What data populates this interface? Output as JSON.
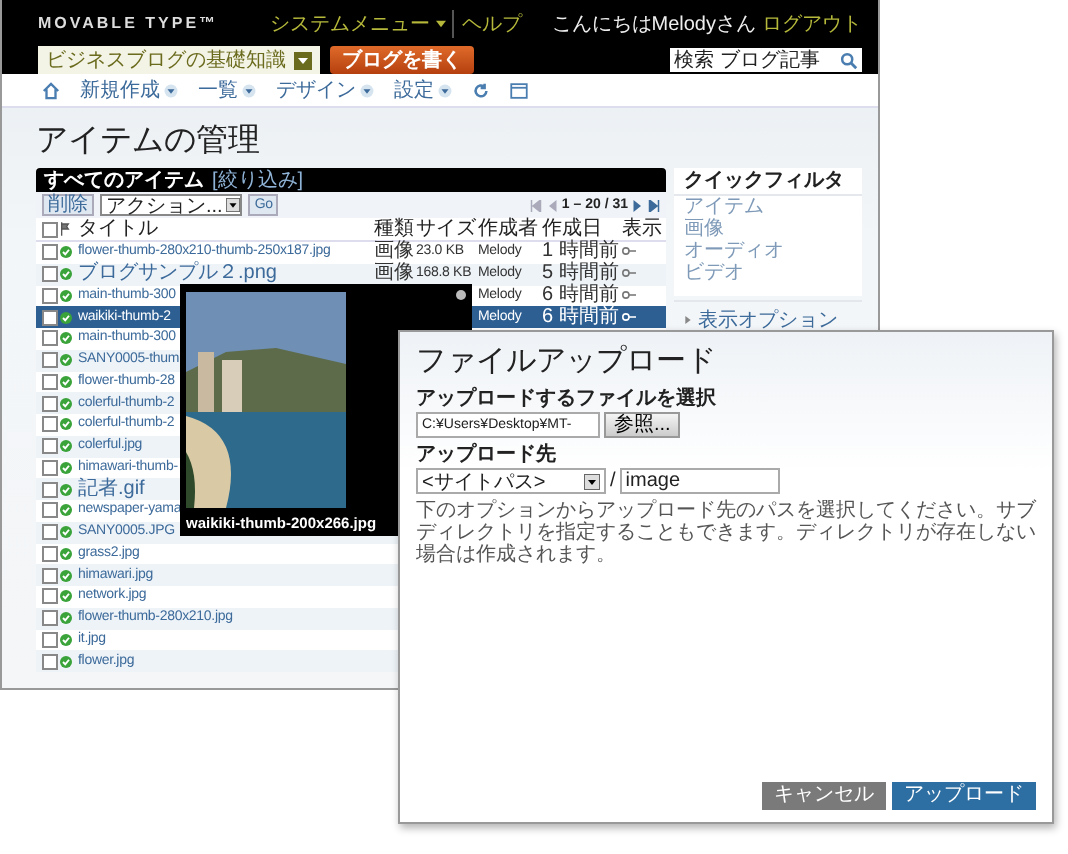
{
  "header": {
    "logo": "MOVABLE TYPE™",
    "system_menu": "システムメニュー",
    "help": "ヘルプ",
    "greeting": "こんにちはMelodyさん",
    "logout": "ログアウト",
    "blog_selector": "ビジネスブログの基礎知識",
    "write_button": "ブログを書く",
    "search": {
      "value": "検索 ブログ記事"
    }
  },
  "nav": {
    "items": [
      "新規作成",
      "一覧",
      "デザイン",
      "設定"
    ]
  },
  "page_title": "アイテムの管理",
  "panel": {
    "title": "すべてのアイテム",
    "filter_link": "[絞り込み]",
    "delete_button": "削除",
    "action_select": "アクション...",
    "go_button": "Go",
    "pager": "1 – 20 / 31"
  },
  "table": {
    "columns": [
      "タイトル",
      "種類",
      "サイズ",
      "作成者",
      "作成日",
      "表示"
    ],
    "select_all": {
      "checked": false
    },
    "rows": [
      {
        "title": "flower-thumb-280x210-thumb-250x187.jpg",
        "selected": false,
        "checked": false,
        "kind": "画像",
        "size": "23.0 KB",
        "author": "Melody",
        "created": "1 時間前"
      },
      {
        "title": "ブログサンプル２.png",
        "selected": false,
        "checked": false,
        "kind": "画像",
        "size": "168.8 KB",
        "author": "Melody",
        "created": "5 時間前"
      },
      {
        "title": "main-thumb-300",
        "selected": false,
        "checked": false,
        "author": "Melody",
        "created": "6 時間前"
      },
      {
        "title": "waikiki-thumb-2",
        "selected": true,
        "checked": false,
        "author": "Melody",
        "created": "6 時間前"
      },
      {
        "title": "main-thumb-300",
        "selected": false,
        "checked": false
      },
      {
        "title": "SANY0005-thum",
        "selected": false,
        "checked": false
      },
      {
        "title": "flower-thumb-28",
        "selected": false,
        "checked": false
      },
      {
        "title": "colerful-thumb-2",
        "selected": false,
        "checked": false
      },
      {
        "title": "colerful-thumb-2",
        "selected": false,
        "checked": false
      },
      {
        "title": "colerful.jpg",
        "selected": false,
        "checked": false
      },
      {
        "title": "himawari-thumb-",
        "selected": false,
        "checked": false
      },
      {
        "title": "記者.gif",
        "selected": false,
        "checked": false
      },
      {
        "title": "newspaper-yama",
        "selected": false,
        "checked": false
      },
      {
        "title": "SANY0005.JPG",
        "selected": false,
        "checked": false
      },
      {
        "title": "grass2.jpg",
        "selected": false,
        "checked": false
      },
      {
        "title": "himawari.jpg",
        "selected": false,
        "checked": false
      },
      {
        "title": "network.jpg",
        "selected": false,
        "checked": false
      },
      {
        "title": "flower-thumb-280x210.jpg",
        "selected": false,
        "checked": false
      },
      {
        "title": "it.jpg",
        "selected": false,
        "checked": false
      },
      {
        "title": "flower.jpg",
        "selected": false,
        "checked": false
      }
    ]
  },
  "sidebar": {
    "title": "クイックフィルタ",
    "items": [
      "アイテム",
      "画像",
      "オーディオ",
      "ビデオ"
    ],
    "display_options": "表示オプション"
  },
  "preview_popup": {
    "caption": "waikiki-thumb-200x266.jpg"
  },
  "dialog": {
    "title": "ファイルアップロード",
    "file_label": "アップロードするファイルを選択",
    "file_value": "C:¥Users¥Desktop¥MT-",
    "browse_button": "参照...",
    "dest_label": "アップロード先",
    "dest_select": "<サイトパス>",
    "separator": "/",
    "dest_path": "image",
    "help": "下のオプションからアップロード先のパスを選択してください。サブディレクトリを指定することもできます。ディレクトリが存在しない場合は作成されます。",
    "cancel_button": "キャンセル",
    "upload_button": "アップロード"
  }
}
